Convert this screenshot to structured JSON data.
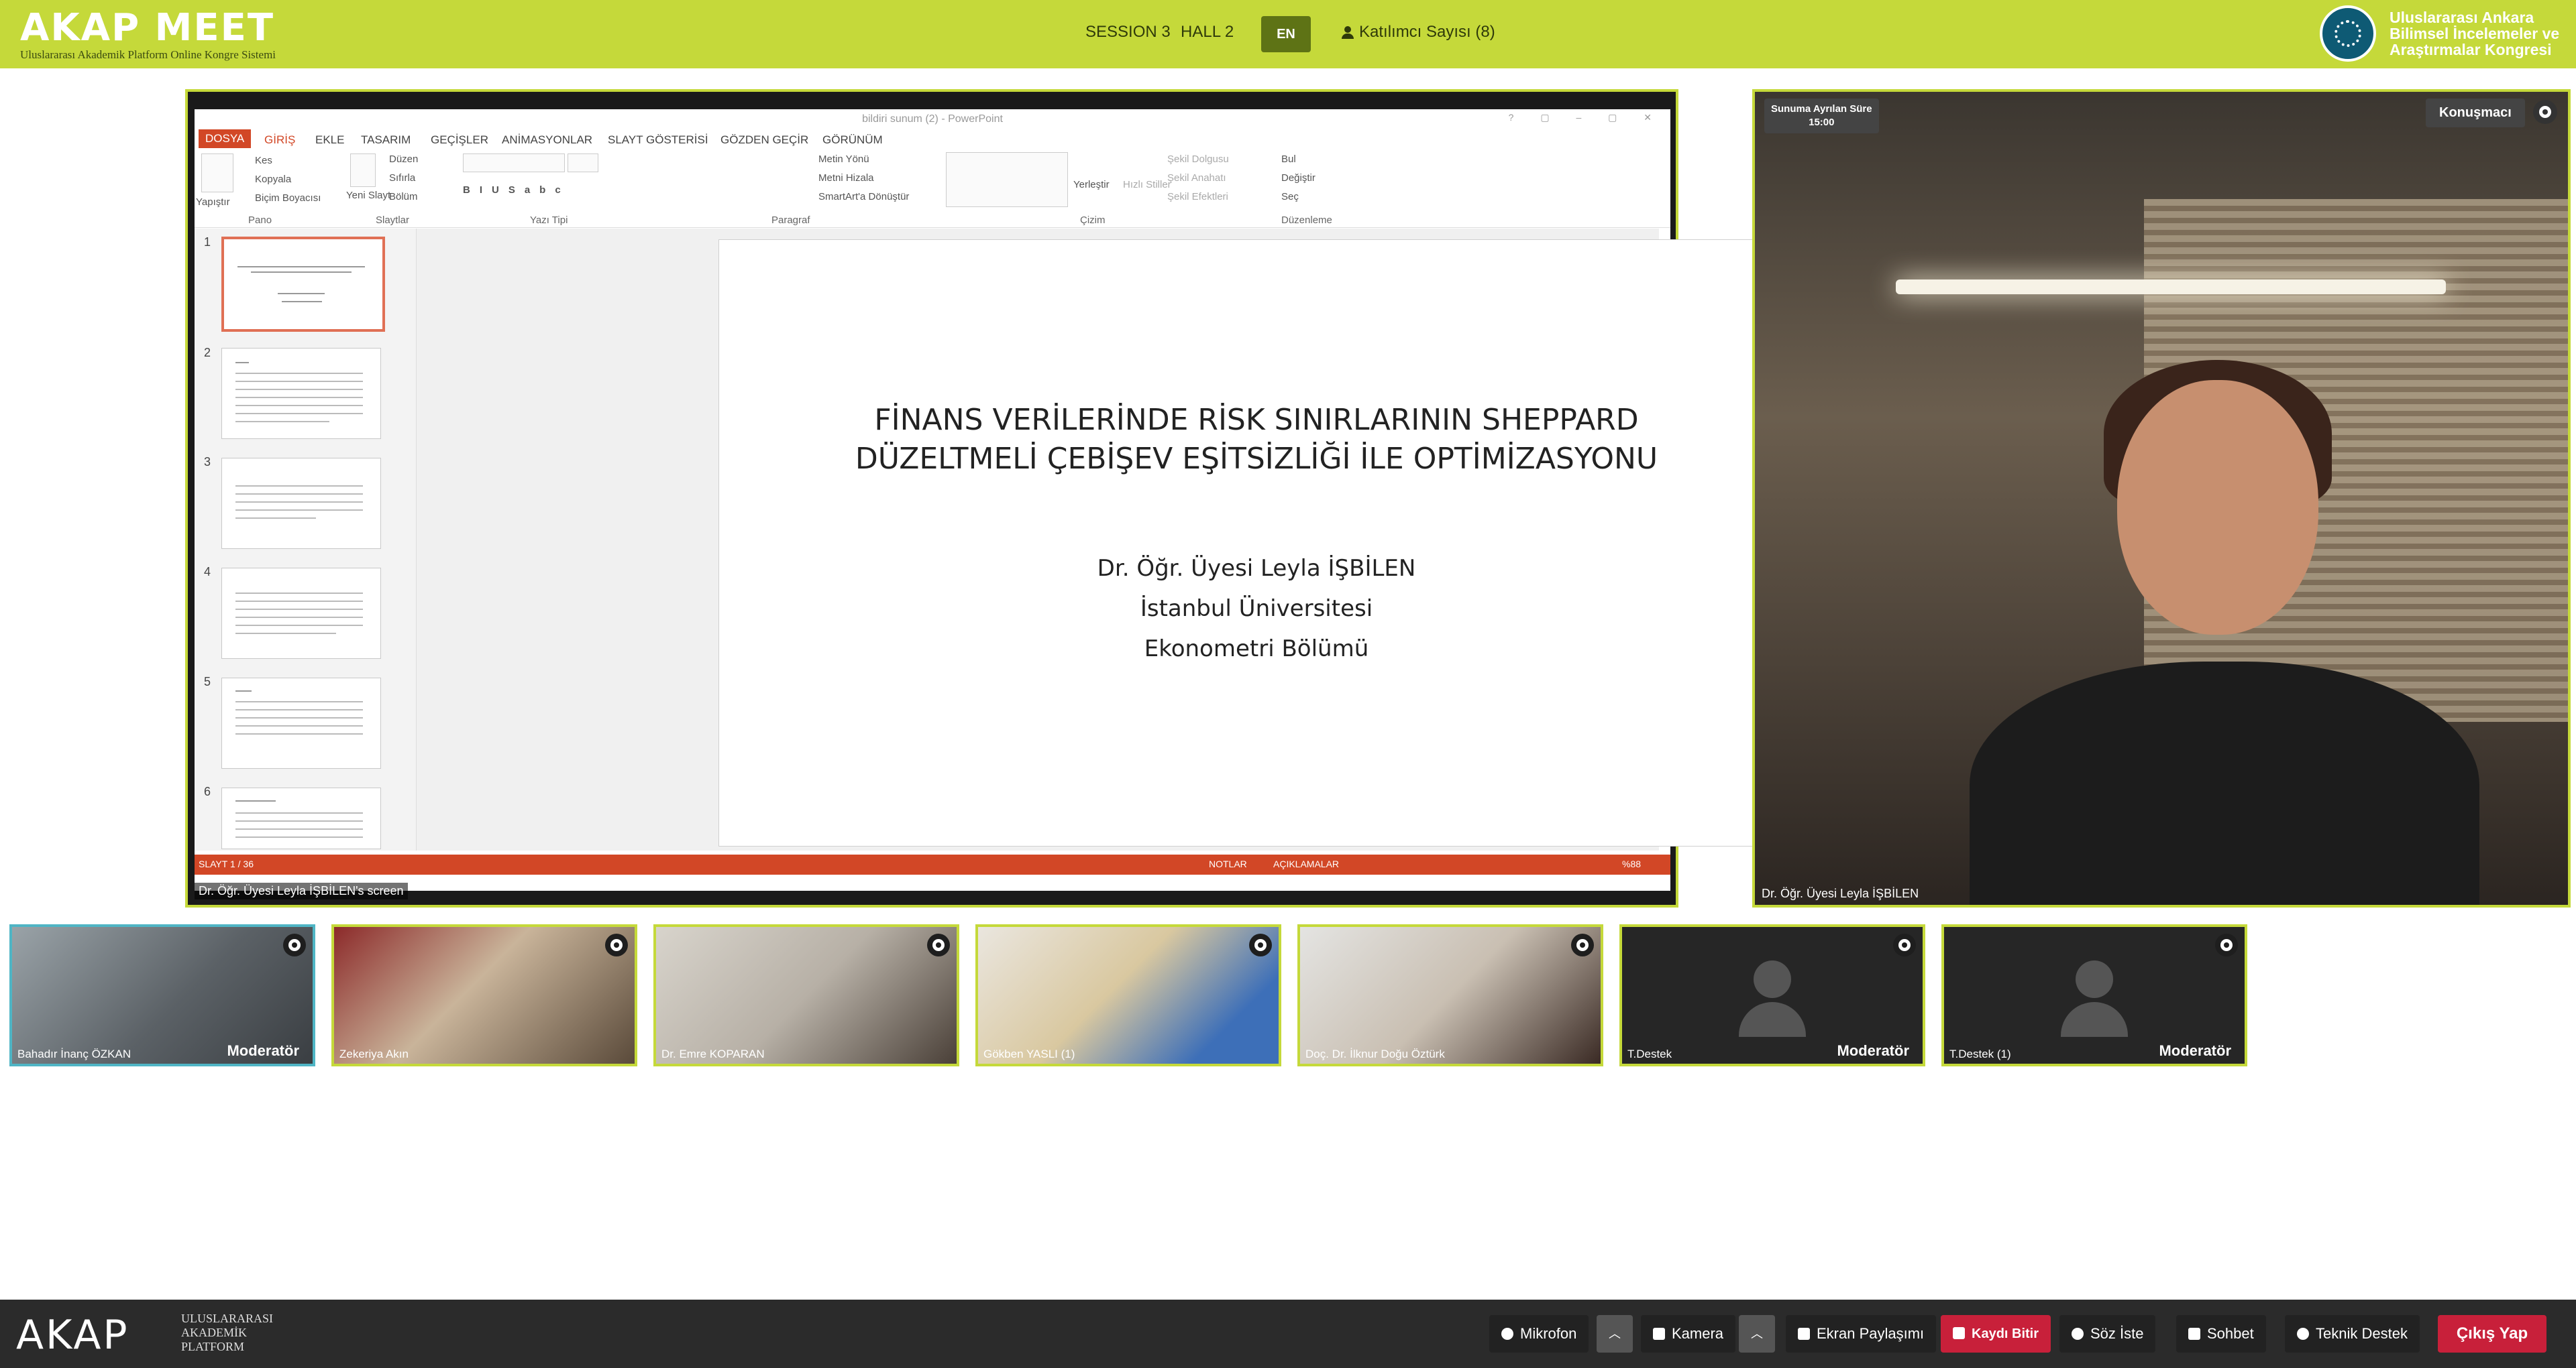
{
  "topbar": {
    "logo_text": "AKAP MEET",
    "logo_sub": "Uluslararası Akademik Platform Online Kongre Sistemi",
    "session": "SESSION 3",
    "hall": "HALL 2",
    "lang_button": "EN",
    "participants": "Katılımcı Sayısı (8)",
    "congress_line1": "Uluslararası Ankara",
    "congress_line2": "Bilimsel İncelemeler ve",
    "congress_line3": "Araştırmalar Kongresi"
  },
  "powerpoint": {
    "window_title": "bildiri sunum (2) - PowerPoint",
    "tabs": [
      "DOSYA",
      "GİRİŞ",
      "EKLE",
      "TASARIM",
      "GEÇİŞLER",
      "ANİMASYONLAR",
      "SLAYT GÖSTERİSİ",
      "GÖZDEN GEÇİR",
      "GÖRÜNÜM"
    ],
    "ribbon": {
      "paste": "Yapıştır",
      "cut": "Kes",
      "copy": "Kopyala",
      "format_painter": "Biçim Boyacısı",
      "new_slide": "Yeni Slayt",
      "layout": "Düzen",
      "reset": "Sıfırla",
      "section": "Bölüm",
      "text_direction": "Metin Yönü",
      "align_text": "Metni Hizala",
      "smartart": "SmartArt'a Dönüştür",
      "arrange": "Yerleştir",
      "quick_styles": "Hızlı Stiller",
      "shape_fill": "Şekil Dolgusu",
      "shape_outline": "Şekil Anahatı",
      "shape_effects": "Şekil Efektleri",
      "find": "Bul",
      "replace": "Değiştir",
      "select": "Seç",
      "groups": [
        "Pano",
        "Slaytlar",
        "Yazı Tipi",
        "Paragraf",
        "Çizim",
        "Düzenleme"
      ]
    },
    "slide_numbers": [
      "1",
      "2",
      "3",
      "4",
      "5",
      "6"
    ],
    "slide_title_line1": "FİNANS VERİLERİNDE RİSK SINIRLARININ SHEPPARD",
    "slide_title_line2": "DÜZELTMELİ ÇEBİŞEV EŞİTSİZLİĞİ İLE OPTİMİZASYONU",
    "author": "Dr. Öğr. Üyesi Leyla İŞBİLEN",
    "university": "İstanbul Üniversitesi",
    "department": "Ekonometri Bölümü",
    "status_slide": "SLAYT 1 / 36",
    "status_notes": "NOTLAR",
    "status_comments": "AÇIKLAMALAR",
    "zoom": "%88"
  },
  "screen_label": "Dr. Öğr. Üyesi Leyla İŞBİLEN's screen",
  "speaker": {
    "timer_label": "Sunuma Ayrılan Süre",
    "timer_value": "15:00",
    "badge": "Konuşmacı",
    "name": "Dr. Öğr. Üyesi Leyla İŞBİLEN"
  },
  "participants": [
    {
      "name": "Bahadır İnanç ÖZKAN",
      "moderator": "Moderatör"
    },
    {
      "name": "Zekeriya Akın",
      "moderator": ""
    },
    {
      "name": "Dr. Emre KOPARAN",
      "moderator": ""
    },
    {
      "name": "Gökben YASLI (1)",
      "moderator": ""
    },
    {
      "name": "Doç. Dr. İlknur Doğu Öztürk",
      "moderator": ""
    },
    {
      "name": "T.Destek",
      "moderator": "Moderatör"
    },
    {
      "name": "T.Destek (1)",
      "moderator": "Moderatör"
    }
  ],
  "bottombar": {
    "logo": "AKAP",
    "logo_sub1": "ULUSLARARASI",
    "logo_sub2": "AKADEMİK",
    "logo_sub3": "PLATFORM",
    "mic": "Mikrofon",
    "camera": "Kamera",
    "screen_share": "Ekran Paylaşımı",
    "stop_record": "Kaydı Bitir",
    "raise_hand": "Söz İste",
    "chat": "Sohbet",
    "tech_support": "Teknik Destek",
    "exit": "Çıkış Yap"
  }
}
